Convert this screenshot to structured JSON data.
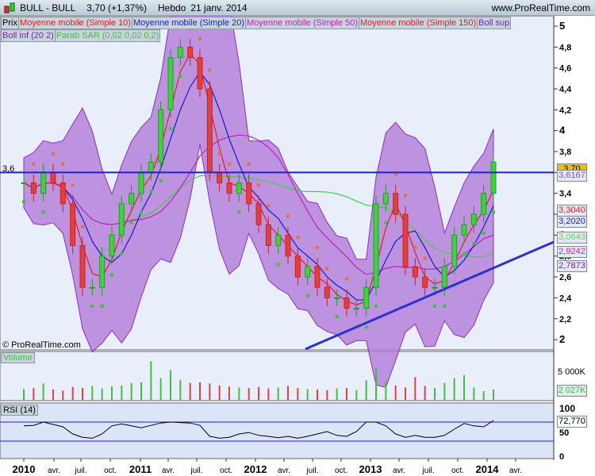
{
  "header": {
    "symbol": "BULL - BULL",
    "quote": "3,70 (+1,37%)",
    "period": "Hebdo",
    "date": "21 janv. 2014",
    "site": "www.ProRealTime.com"
  },
  "legend": [
    {
      "label": "Prix",
      "color": "#000000"
    },
    {
      "label": "Moyenne mobile (Simple 10)",
      "color": "#e02020"
    },
    {
      "label": "Moyenne mobile (Simple 20)",
      "color": "#1a1acc"
    },
    {
      "label": "Moyenne mobile (Simple 50)",
      "color": "#c020c0"
    },
    {
      "label": "Moyenne mobile (Simple 150)",
      "color": "#e02020"
    },
    {
      "label": "Boll sup",
      "color": "#7a20c0"
    },
    {
      "label": "Boll inf (20 2)",
      "color": "#7a20c0"
    },
    {
      "label": "Parab SAR (0,02 0,02 0,2)",
      "color": "#40c040"
    }
  ],
  "copyright": "© ProRealTime.com",
  "chart_data": [
    {
      "type": "candlestick",
      "panel": "price",
      "ylim": [
        2,
        5
      ],
      "yticks": [
        "5",
        "4,8",
        "4,6",
        "4,4",
        "4,2",
        "4",
        "3,8",
        "3,6",
        "3,4",
        "3,2",
        "3",
        "2,8",
        "2,6",
        "2,4",
        "2,2",
        "2"
      ],
      "xticks": [
        "2010",
        "avr.",
        "juil.",
        "oct.",
        "2011",
        "avr.",
        "juil.",
        "oct.",
        "2012",
        "avr.",
        "juil.",
        "oct.",
        "2013",
        "avr.",
        "juil.",
        "oct.",
        "2014",
        "avr."
      ],
      "closes": [
        3.5,
        3.4,
        3.6,
        3.5,
        3.3,
        2.9,
        2.5,
        2.5,
        2.8,
        3.0,
        3.3,
        3.4,
        3.6,
        3.7,
        4.2,
        4.7,
        4.8,
        4.7,
        4.4,
        3.6,
        3.5,
        3.4,
        3.5,
        3.3,
        3.1,
        2.9,
        3.0,
        2.8,
        2.6,
        2.7,
        2.5,
        2.4,
        2.4,
        2.3,
        2.3,
        2.5,
        3.3,
        3.4,
        3.2,
        2.7,
        2.6,
        2.5,
        2.5,
        2.7,
        3.0,
        3.1,
        3.2,
        3.4,
        3.7
      ],
      "horizontal_line": {
        "value": 3.6,
        "label": "3,6"
      },
      "value_tags": [
        {
          "label": "3,70",
          "color": "#f0c000"
        },
        {
          "label": "3,6167",
          "color": "#8050c0"
        },
        {
          "label": "3,3040",
          "color": "#e02020"
        },
        {
          "label": "3,2020",
          "color": "#1a1acc"
        },
        {
          "label": "3,0643",
          "color": "#60d060"
        },
        {
          "label": "2,9242",
          "color": "#c020c0"
        },
        {
          "label": "2,7873",
          "color": "#7a20c0"
        }
      ]
    },
    {
      "type": "bar",
      "panel": "volume",
      "title": "Volume",
      "ytick": "5 000K",
      "last": "2 027K",
      "values": [
        2100,
        2300,
        3200,
        2000,
        1800,
        2500,
        2300,
        2700,
        2200,
        2600,
        2800,
        3300,
        3400,
        7500,
        4200,
        5800,
        3900,
        3300,
        3400,
        3200,
        2800,
        2600,
        2400,
        2300,
        2500,
        2200,
        2400,
        2700,
        2300,
        2100,
        2000,
        1900,
        2200,
        2300,
        1900,
        3800,
        6200,
        3600,
        2800,
        2400,
        4400,
        2700,
        2300,
        3300,
        4200,
        4800,
        2400,
        1700,
        2027
      ]
    },
    {
      "type": "line",
      "panel": "rsi",
      "title": "RSI (14)",
      "yticks": [
        "100",
        "50",
        "0"
      ],
      "levels": [
        70,
        30
      ],
      "last": "72,770",
      "values": [
        62,
        63,
        70,
        65,
        60,
        45,
        38,
        36,
        45,
        62,
        66,
        62,
        58,
        63,
        68,
        70,
        69,
        68,
        63,
        40,
        36,
        38,
        45,
        48,
        42,
        40,
        37,
        40,
        36,
        40,
        45,
        50,
        42,
        40,
        50,
        70,
        70,
        62,
        45,
        38,
        42,
        38,
        38,
        42,
        55,
        67,
        62,
        60,
        73
      ]
    }
  ]
}
